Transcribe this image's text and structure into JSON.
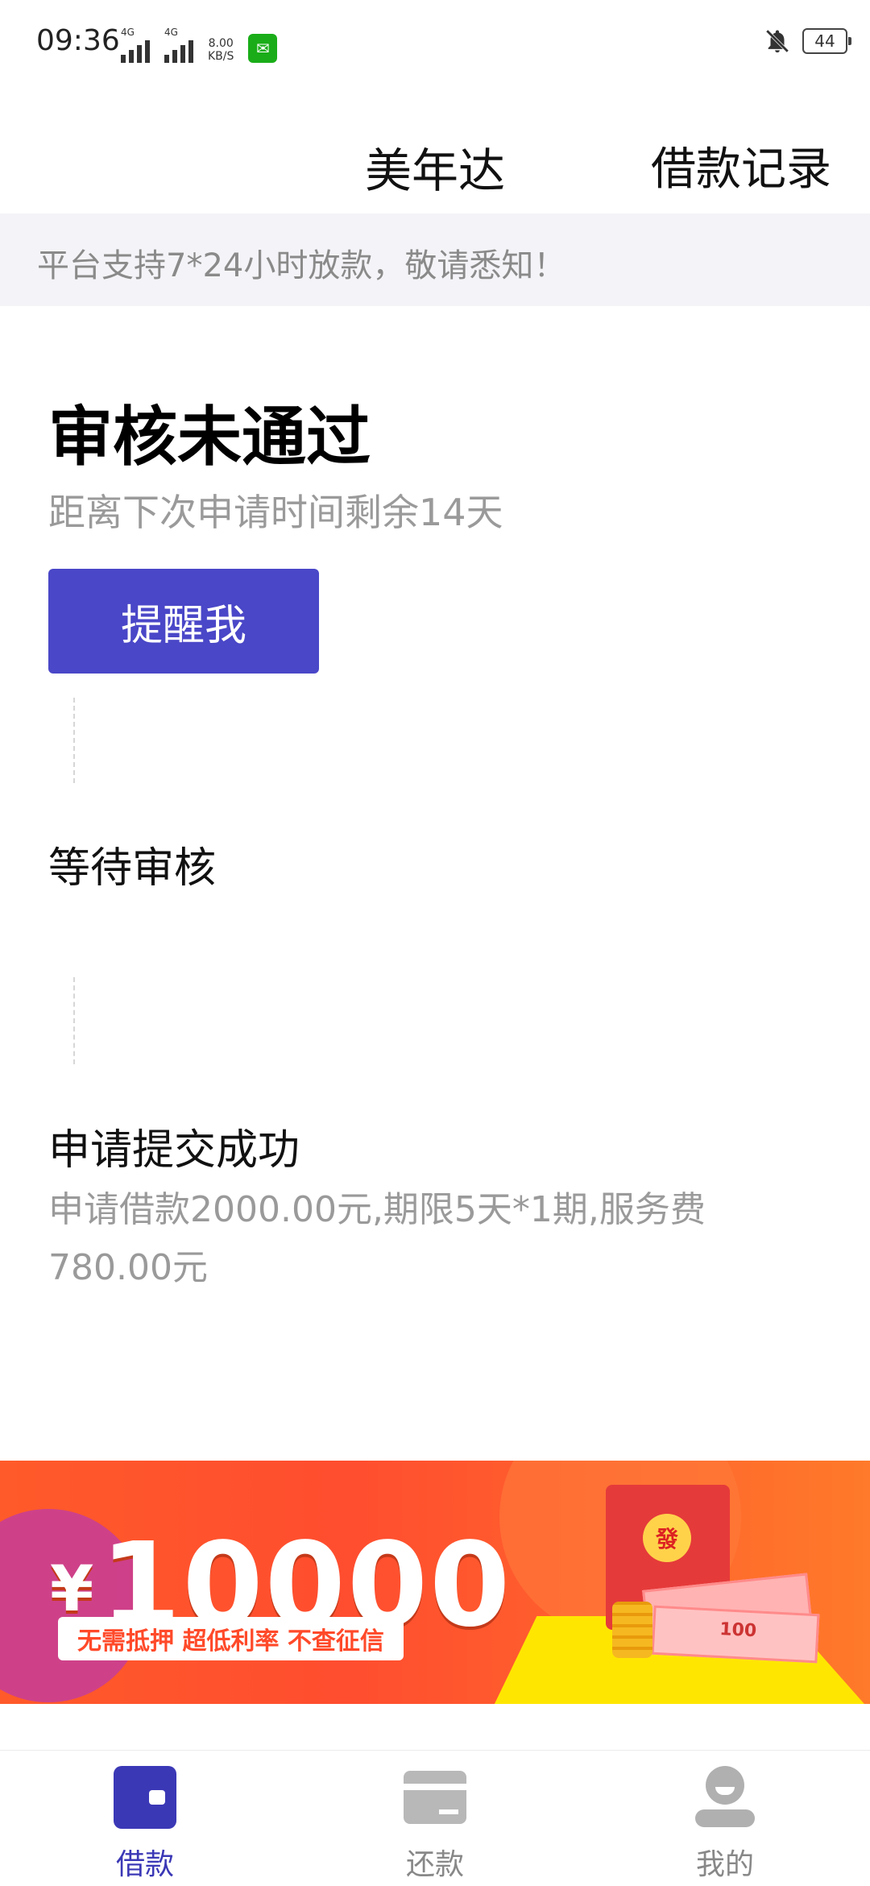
{
  "status_bar": {
    "time": "09:36",
    "sim1_label": "4G",
    "sim2_label": "4G",
    "net_speed_value": "8.00",
    "net_speed_unit": "KB/S",
    "battery": "44"
  },
  "header": {
    "title": "美年达",
    "records_link": "借款记录"
  },
  "notice": {
    "text": "平台支持7*24小时放款，敬请悉知！"
  },
  "review": {
    "status_title": "审核未通过",
    "status_subtitle": "距离下次申请时间剩余14天",
    "remind_button": "提醒我"
  },
  "steps": [
    {
      "title": "等待审核"
    },
    {
      "title": "申请提交成功",
      "desc": "申请借款2000.00元,期限5天*1期,服务费780.00元"
    }
  ],
  "banner": {
    "currency": "¥",
    "amount": "10000",
    "tagline": "无需抵押  超低利率  不查征信",
    "envelope_char": "發",
    "cash_label": "100"
  },
  "bottom_nav": {
    "items": [
      {
        "label": "借款",
        "icon": "wallet-icon",
        "active": true
      },
      {
        "label": "还款",
        "icon": "card-icon",
        "active": false
      },
      {
        "label": "我的",
        "icon": "user-icon",
        "active": false
      }
    ]
  },
  "colors": {
    "accent": "#4a47c8",
    "nav_active": "#3b38b6",
    "notice_bg": "#f4f4f8",
    "muted_text": "#9a9a9a",
    "banner_orange": "#ff4d2f"
  }
}
